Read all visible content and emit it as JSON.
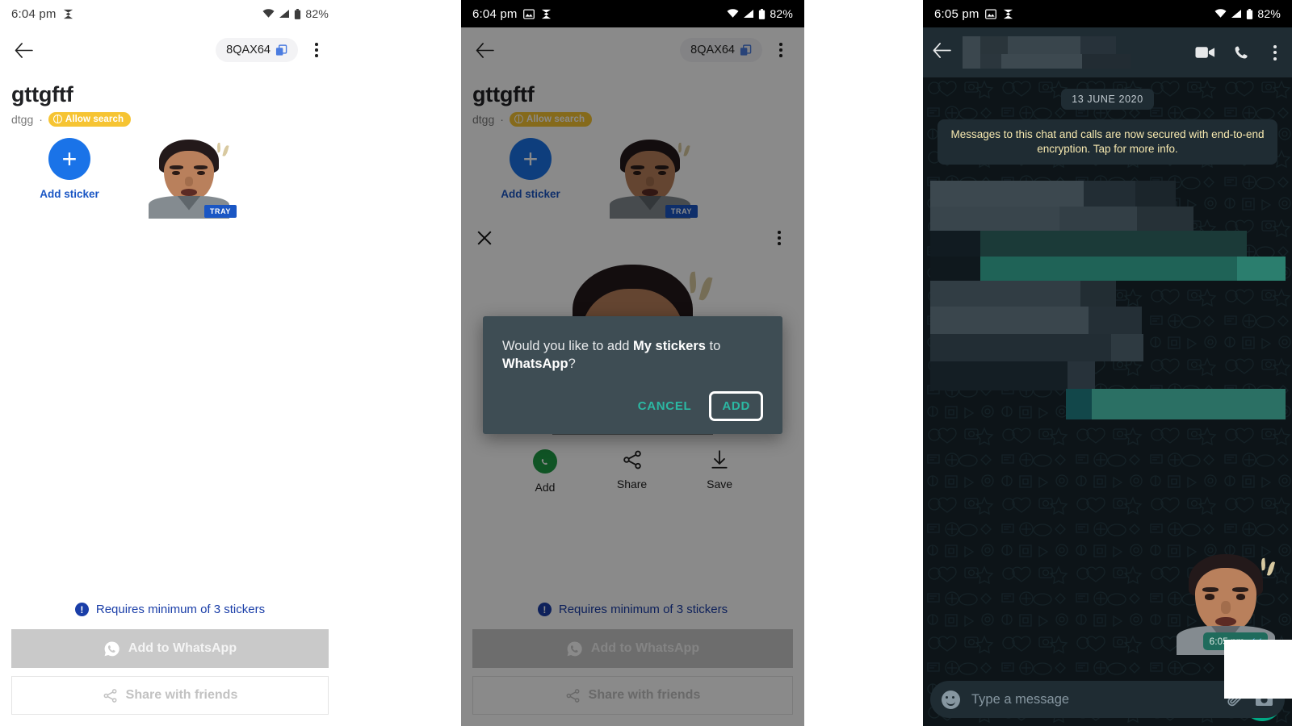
{
  "panel1": {
    "status": {
      "time": "6:04 pm",
      "app_icon": "snapchat-icon",
      "wifi": "wifi-icon",
      "signal": "signal-icon",
      "battery": "82%"
    },
    "appbar": {
      "back": "back-arrow-icon",
      "chip_label": "8QAX64",
      "chip_icon": "copy-icon",
      "overflow": "overflow-menu-icon"
    },
    "pack": {
      "title": "gttgftf",
      "author": "dtgg",
      "separator": "·",
      "badge": "Allow search",
      "badge_icon": "globe-icon"
    },
    "grid": {
      "add_icon": "plus-icon",
      "add_label": "Add sticker",
      "sticker_tag": "TRAY"
    },
    "footer": {
      "requirement": "Requires minimum of 3 stickers",
      "requirement_icon": "info-icon",
      "primary_label": "Add to WhatsApp",
      "primary_icon": "whatsapp-icon",
      "outline_label": "Share with friends",
      "outline_icon": "share-icon"
    }
  },
  "panel2": {
    "status": {
      "time": "6:04 pm",
      "gallery_icon": "image-icon",
      "app_icon": "snapchat-icon",
      "wifi": "wifi-icon",
      "signal": "signal-icon",
      "battery": "82%"
    },
    "appbar": {
      "back": "back-arrow-icon",
      "chip_label": "8QAX64",
      "chip_icon": "copy-icon",
      "overflow": "overflow-menu-icon"
    },
    "pack": {
      "title": "gttgftf",
      "author": "dtgg",
      "separator": "·",
      "badge": "Allow search",
      "badge_icon": "globe-icon"
    },
    "grid": {
      "add_icon": "plus-icon",
      "add_label": "Add sticker",
      "sticker_tag": "TRAY"
    },
    "preview": {
      "close_icon": "close-icon",
      "overflow_icon": "overflow-menu-icon",
      "actions": [
        {
          "label": "Add",
          "icon": "whatsapp-icon"
        },
        {
          "label": "Share",
          "icon": "share-icon"
        },
        {
          "label": "Save",
          "icon": "download-icon"
        }
      ]
    },
    "dialog": {
      "text_before": "Would you like to add ",
      "text_bold": "My stickers",
      "text_middle": " to ",
      "text_bold2": "WhatsApp",
      "text_after": "?",
      "cancel_label": "CANCEL",
      "add_label": "ADD",
      "highlighted_button": "ADD",
      "bg_color": "#3e4d54",
      "accent_color": "#2bb8a3"
    },
    "footer": {
      "requirement": "Requires minimum of 3 stickers",
      "requirement_icon": "info-icon",
      "primary_label": "Add to WhatsApp",
      "primary_icon": "whatsapp-icon",
      "outline_label": "Share with friends",
      "outline_icon": "share-icon"
    }
  },
  "panel3": {
    "status": {
      "time": "6:05 pm",
      "gallery_icon": "image-icon",
      "app_icon": "snapchat-icon",
      "wifi": "wifi-icon",
      "signal": "signal-icon",
      "battery": "82%"
    },
    "appbar": {
      "back": "back-arrow-icon",
      "contact_name": "",
      "contact_status": "",
      "video_call_icon": "video-call-icon",
      "voice_call_icon": "phone-icon",
      "overflow_icon": "overflow-menu-icon"
    },
    "chat": {
      "date_chip": "13 JUNE 2020",
      "encryption_notice": "Messages to this chat and calls are now secured with end-to-end encryption. Tap for more info.",
      "sticker_message": {
        "timestamp": "6:05 pm",
        "status_icon": "double-check-icon"
      }
    },
    "composer": {
      "emoji_icon": "emoji-icon",
      "placeholder": "Type a message",
      "attach_icon": "paperclip-icon",
      "camera_icon": "camera-icon",
      "send_icon": "mic-icon"
    },
    "colors": {
      "bubble_outgoing": "#005c4b",
      "accent": "#00a884",
      "header": "#1f2c33",
      "background": "#0d1418"
    }
  }
}
